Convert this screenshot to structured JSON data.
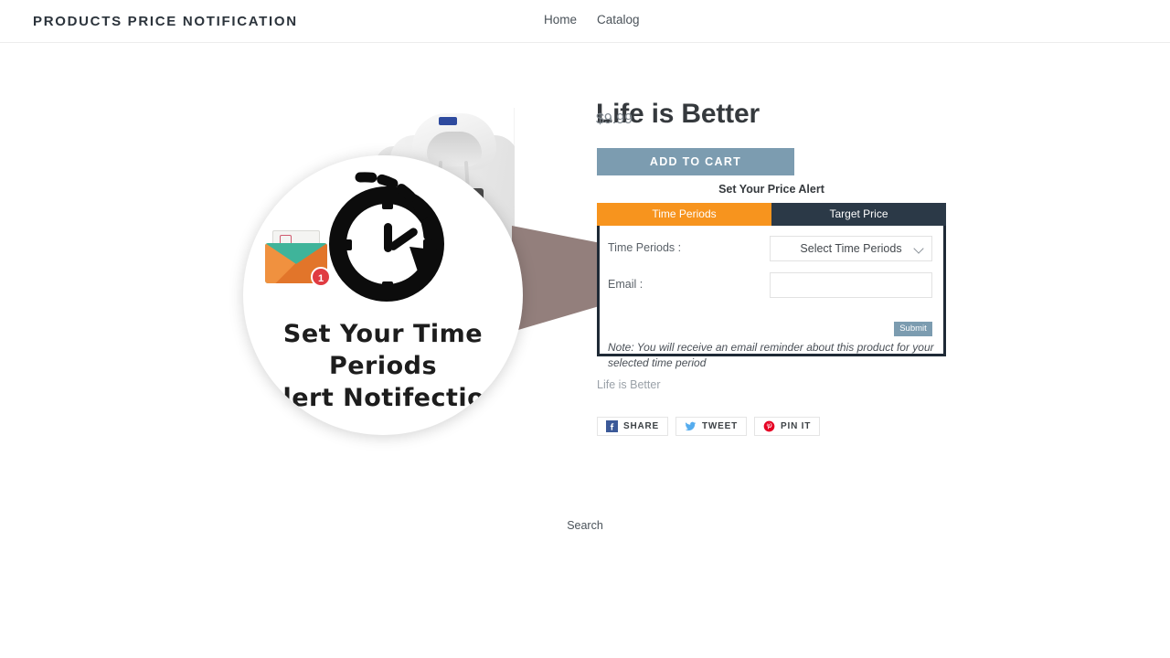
{
  "header": {
    "brand": "PRODUCTS PRICE NOTIFICATION",
    "nav": [
      {
        "label": "Home"
      },
      {
        "label": "Catalog"
      }
    ]
  },
  "product": {
    "title": "Life is Better",
    "price": "$9.99",
    "add_to_cart_label": "ADD TO CART",
    "vendor": "Life is Better",
    "image_alt": "white-hoodie"
  },
  "overlay": {
    "caption_line1": "Set Your Time Periods",
    "caption_line2": "Alert Notifection",
    "envelope_badge": "1"
  },
  "price_alert": {
    "heading": "Set Your Price Alert",
    "tabs": [
      {
        "label": "Time Periods",
        "active": true
      },
      {
        "label": "Target Price",
        "active": false
      }
    ],
    "fields": {
      "time_periods_label": "Time Periods :",
      "time_periods_value": "Select Time Periods",
      "email_label": "Email :",
      "email_value": "",
      "email_placeholder": ""
    },
    "submit_label": "Submit",
    "note": "Note: You will receive an email reminder about this product for your selected time period"
  },
  "share": [
    {
      "label": "SHARE",
      "icon": "facebook-icon",
      "color": "#3b5998"
    },
    {
      "label": "TWEET",
      "icon": "twitter-icon",
      "color": "#55acee"
    },
    {
      "label": "PIN IT",
      "icon": "pinterest-icon",
      "color": "#e60023"
    }
  ],
  "footer": {
    "search_label": "Search"
  },
  "colors": {
    "tab_active": "#f7941e",
    "tab_inactive": "#2b3947",
    "widget_border": "#1f2a36",
    "button_blue": "#7c9cb0",
    "text_dark": "#35393d"
  }
}
